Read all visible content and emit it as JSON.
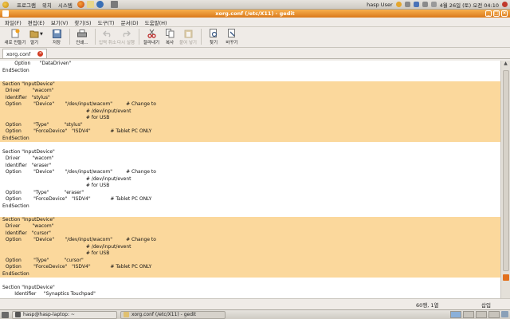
{
  "top_panel": {
    "menus": [
      "프로그램",
      "위치",
      "시스템"
    ],
    "user": "hasp User",
    "date": "4월 26일 (토) 오전 04:10"
  },
  "window": {
    "title": "xorg.conf (/etc/X11) - gedit",
    "menubar": [
      "파일(F)",
      "편집(E)",
      "보기(V)",
      "찾기(S)",
      "도구(T)",
      "문서(D)",
      "도움말(H)"
    ],
    "toolbar": {
      "new": "새로 만들기",
      "open": "열기",
      "save": "저장",
      "print": "인쇄...",
      "undo": "입력 취소",
      "redo": "다시 실행",
      "cut": "잘라내기",
      "copy": "복사",
      "paste": "붙여 넣기",
      "find": "찾기",
      "replace": "바꾸기"
    },
    "tab": {
      "label": "xorg.conf"
    }
  },
  "editor_lines": [
    {
      "t": "        Option      \"DataDriven\"",
      "h": false
    },
    {
      "t": "EndSection",
      "h": false
    },
    {
      "t": "",
      "h": false
    },
    {
      "t": "Section \"InputDevice\"",
      "h": true
    },
    {
      "t": "  Driver        \"wacom\"",
      "h": true
    },
    {
      "t": "  Identifier   \"stylus\"",
      "h": true
    },
    {
      "t": "  Option        \"Device\"       \"/dev/input/wacom\"         # Change to",
      "h": true
    },
    {
      "t": "                                                       # /dev/input/event",
      "h": true
    },
    {
      "t": "                                                       # for USB",
      "h": true
    },
    {
      "t": "  Option        \"Type\"          \"stylus\"",
      "h": true
    },
    {
      "t": "  Option        \"ForceDevice\"   \"ISDV4\"             # Tablet PC ONLY",
      "h": true
    },
    {
      "t": "EndSection",
      "h": true
    },
    {
      "t": "",
      "h": false
    },
    {
      "t": "Section \"InputDevice\"",
      "h": false
    },
    {
      "t": "  Driver        \"wacom\"",
      "h": false
    },
    {
      "t": "  Identifier   \"eraser\"",
      "h": false
    },
    {
      "t": "  Option        \"Device\"       \"/dev/input/wacom\"         # Change to",
      "h": false
    },
    {
      "t": "                                                       # /dev/input/event",
      "h": false
    },
    {
      "t": "                                                       # for USB",
      "h": false
    },
    {
      "t": "  Option        \"Type\"          \"eraser\"",
      "h": false
    },
    {
      "t": "  Option        \"ForceDevice\"   \"ISDV4\"             # Tablet PC ONLY",
      "h": false
    },
    {
      "t": "EndSection",
      "h": false
    },
    {
      "t": "",
      "h": false
    },
    {
      "t": "Section \"InputDevice\"",
      "h": true
    },
    {
      "t": "  Driver        \"wacom\"",
      "h": true
    },
    {
      "t": "  Identifier   \"cursor\"",
      "h": true
    },
    {
      "t": "  Option        \"Device\"       \"/dev/input/wacom\"         # Change to",
      "h": true
    },
    {
      "t": "                                                       # /dev/input/event",
      "h": true
    },
    {
      "t": "                                                       # for USB",
      "h": true
    },
    {
      "t": "  Option        \"Type\"          \"cursor\"",
      "h": true
    },
    {
      "t": "  Option        \"ForceDevice\"   \"ISDV4\"             # Tablet PC ONLY",
      "h": true
    },
    {
      "t": "EndSection",
      "h": true
    },
    {
      "t": "",
      "h": false
    },
    {
      "t": "Section \"InputDevice\"",
      "h": false
    },
    {
      "t": "        Identifier     \"Synaptics Touchpad\"",
      "h": false
    }
  ],
  "status": {
    "position": "60행, 1열",
    "mode": "삽입"
  },
  "taskbar": {
    "tasks": [
      "hasp@hasp-laptop: ~",
      "xorg.conf (/etc/X11) - gedit"
    ]
  },
  "colors": {
    "highlight": "#fbd89c",
    "title_orange": "#e2821f"
  }
}
